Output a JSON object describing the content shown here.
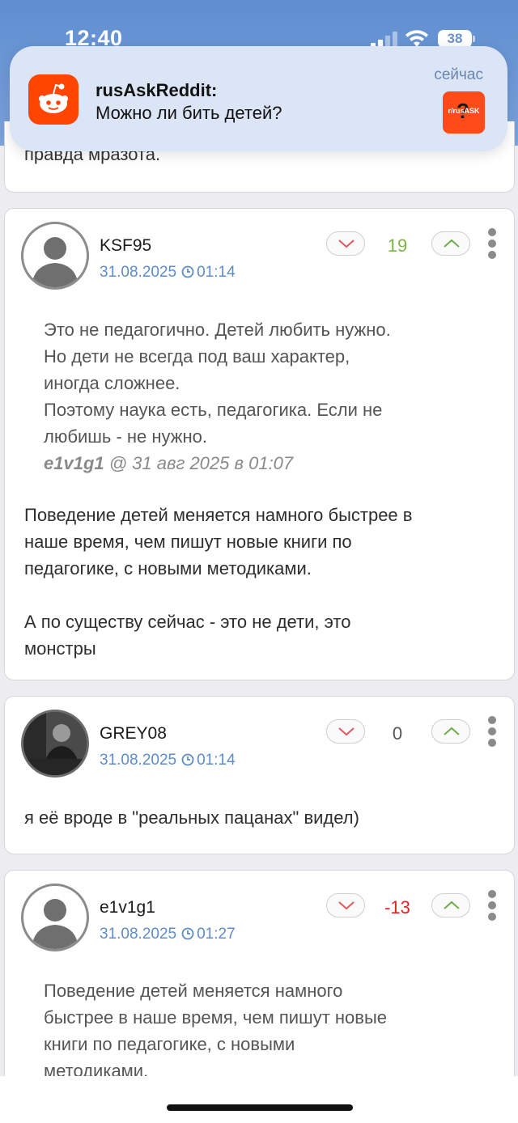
{
  "status_bar": {
    "time": "12:40",
    "battery": "38"
  },
  "notification": {
    "app": "rusAskReddit:",
    "message": "Можно ли бить детей?",
    "time": "сейчас",
    "thumb_label": "r/rusASK",
    "thumb_mark": "?"
  },
  "prev_comment": {
    "text_tail": "правда мразота."
  },
  "comments": [
    {
      "username": "KSF95",
      "date": "31.08.2025",
      "time": "01:14",
      "score": "19",
      "score_color": "#7fb24a",
      "quote_lines": [
        "Это не педагогично. Детей любить нужно.",
        "Но дети не всегда под ваш характер,",
        "иногда сложнее.",
        "Поэтому наука есть, педагогика. Если не",
        "любишь - не нужно."
      ],
      "quote_author": "e1v1g1",
      "quote_meta": " @ 31 авг 2025 в 01:07",
      "body_lines": [
        "Поведение детей меняется намного быстрее в",
        "наше время, чем пишут новые книги по",
        "педагогике, с новыми методиками.",
        "",
        "А по существу сейчас - это не дети, это",
        "монстры"
      ]
    },
    {
      "username": "GREY08",
      "date": "31.08.2025",
      "time": "01:14",
      "score": "0",
      "score_color": "#555555",
      "body_lines": [
        "я её вроде в \"реальных пацанах\" видел)"
      ]
    },
    {
      "username": "e1v1g1",
      "date": "31.08.2025",
      "time": "01:27",
      "score": "-13",
      "score_color": "#e02424",
      "quote_lines": [
        "Поведение детей меняется намного",
        "быстрее в наше время, чем пишут новые",
        "книги по педагогике, с новыми",
        "методиками."
      ]
    }
  ],
  "colors": {
    "accent_link": "#5d8cc8",
    "reddit_orange": "#ff4500",
    "vote_down": "#e0595f",
    "vote_up": "#6fae4c"
  },
  "icons": [
    "reddit-icon",
    "clock-icon",
    "chevron-down-icon",
    "chevron-up-icon",
    "kebab-menu-icon",
    "default-avatar-icon"
  ]
}
